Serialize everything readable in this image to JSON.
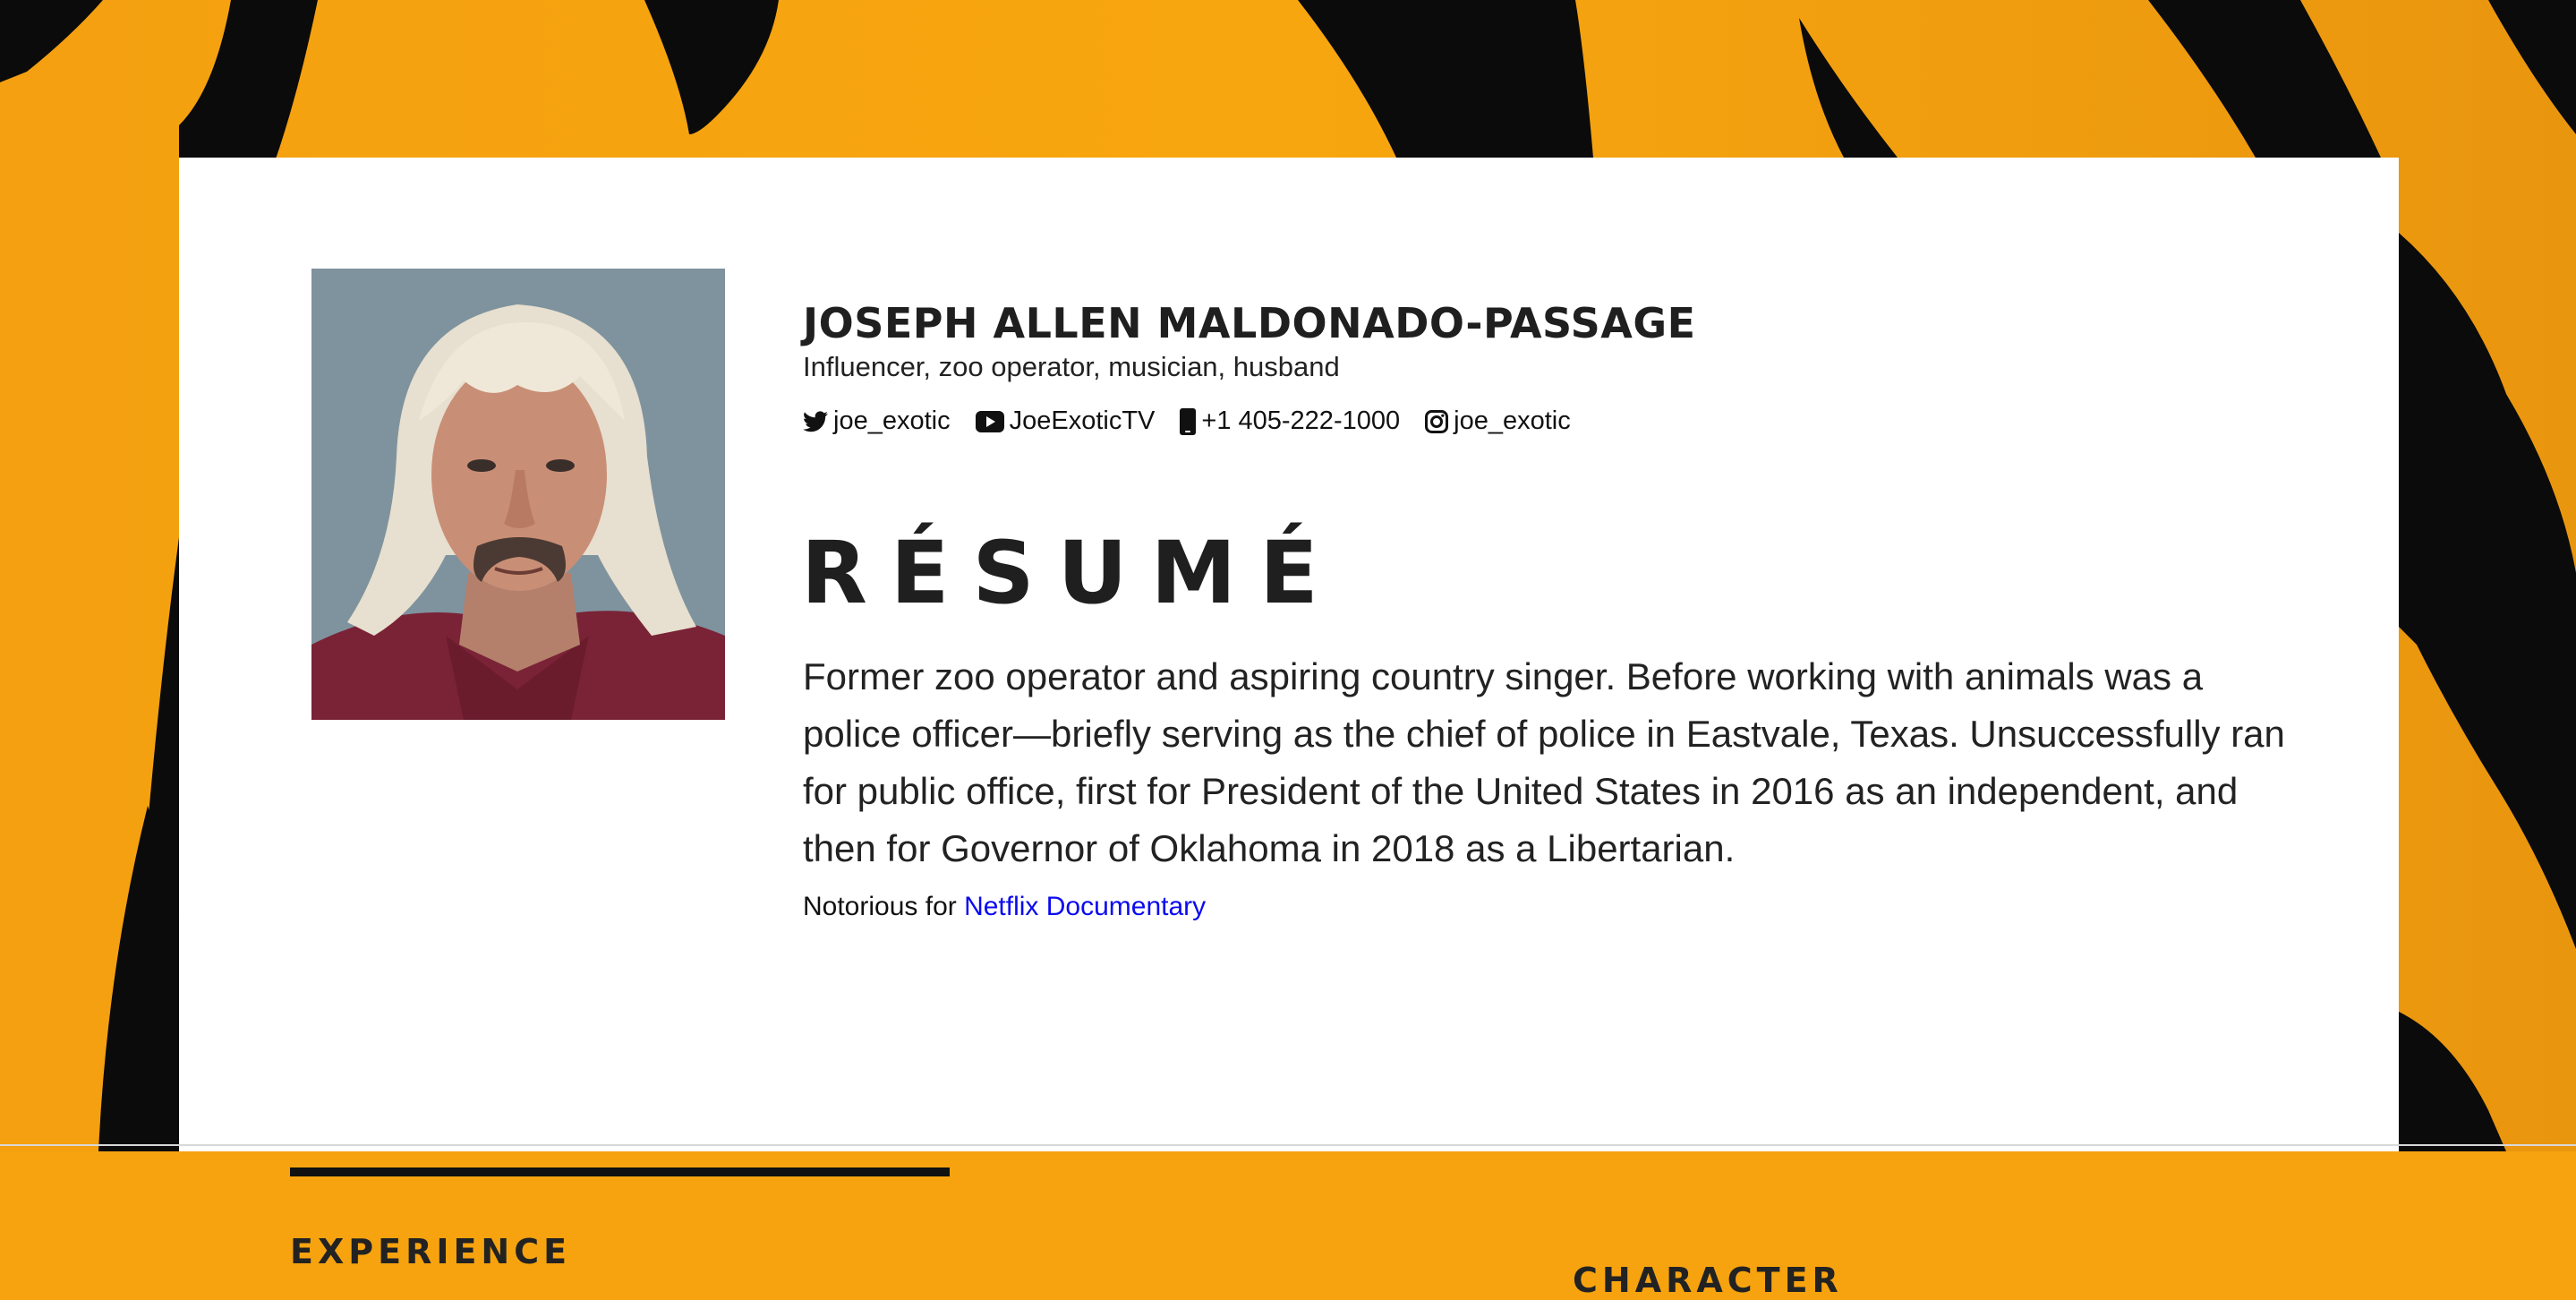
{
  "colors": {
    "stripe_orange": "#f6a30f",
    "stripe_black": "#0b0b0b",
    "card_background": "#ffffff",
    "link_blue": "#0a0af0"
  },
  "profile": {
    "photo_icon": "portrait-photo",
    "name": "JOSEPH ALLEN MALDONADO-PASSAGE",
    "tagline": "Influencer, zoo operator, musician, husband",
    "socials": [
      {
        "icon": "twitter-icon",
        "label": "joe_exotic"
      },
      {
        "icon": "youtube-icon",
        "label": "JoeExoticTV"
      },
      {
        "icon": "phone-icon",
        "label": "+1 405-222-1000"
      },
      {
        "icon": "instagram-icon",
        "label": "joe_exotic"
      }
    ]
  },
  "resume": {
    "title": "RÉSUMÉ",
    "summary": "Former zoo operator and aspiring country singer. Before working with animals was a police officer—briefly serving as the chief of police in Eastvale, Texas. Unsuccessfully ran for public office, first for President of the United States in 2016 as an independent, and then for Governor of Oklahoma in 2018 as a Libertarian.",
    "notorious_prefix": "Notorious for ",
    "notorious_link": "Netflix Documentary"
  },
  "sections": {
    "experience": "EXPERIENCE",
    "character": "CHARACTER"
  }
}
